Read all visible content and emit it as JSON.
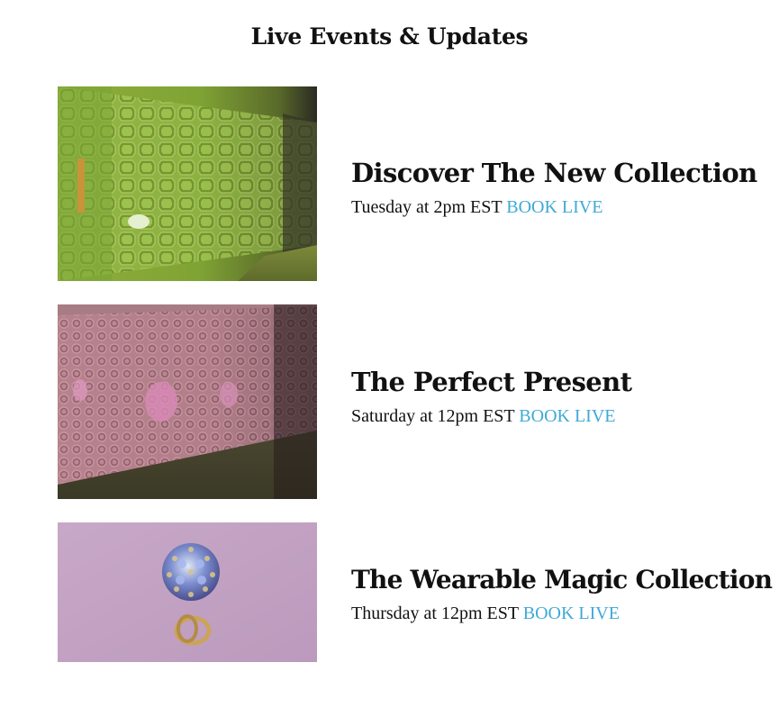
{
  "section": {
    "title": "Live Events & Updates"
  },
  "events": [
    {
      "title": "Discover The New Collection",
      "schedule": "Tuesday at 2pm EST",
      "cta_label": "BOOK LIVE",
      "image_theme": "green-display-wall"
    },
    {
      "title": "The Perfect Present",
      "schedule": "Saturday at 12pm EST",
      "cta_label": "BOOK LIVE",
      "image_theme": "pink-display-wall"
    },
    {
      "title": "The Wearable Magic Collection",
      "schedule": "Thursday at 12pm EST",
      "cta_label": "BOOK LIVE",
      "image_theme": "sapphire-ring"
    }
  ],
  "colors": {
    "link": "#3fa9d6",
    "text": "#111111",
    "background": "#ffffff"
  }
}
